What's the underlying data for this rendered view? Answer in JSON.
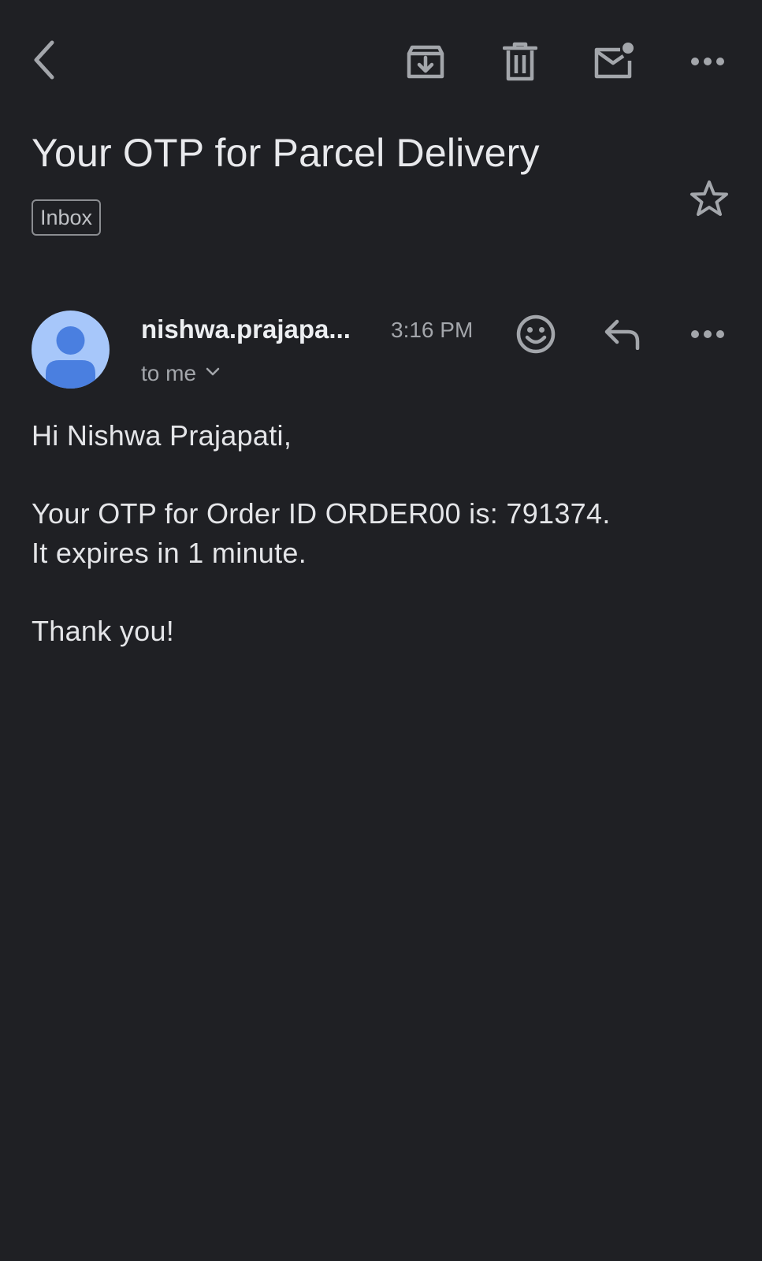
{
  "toolbar": {
    "back_icon": "chevron-left-icon",
    "archive_icon": "archive-icon",
    "delete_icon": "trash-icon",
    "mark_unread_icon": "mail-unread-icon",
    "more_icon": "more-horizontal-icon"
  },
  "email": {
    "subject": "Your OTP for Parcel Delivery",
    "label": "Inbox",
    "starred": false,
    "sender": "nishwa.prajapa...",
    "time": "3:16 PM",
    "recipient": "to me",
    "body": {
      "greeting": "Hi Nishwa Prajapati,",
      "line1": "Your OTP for Order ID ORDER00 is: 791374.",
      "line2": "It expires in 1 minute.",
      "closing": "Thank you!"
    }
  },
  "colors": {
    "background": "#1f2024",
    "icon": "#a3a6ab",
    "avatar_bg": "#a7c7fa",
    "avatar_fg": "#4a7fe0"
  }
}
